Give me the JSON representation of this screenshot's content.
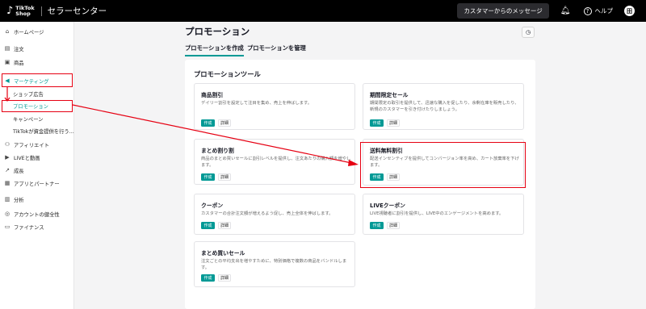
{
  "header": {
    "logo_brand_line1": "TikTok",
    "logo_brand_line2": "Shop",
    "app_title": "セラーセンター",
    "messages_button": "カスタマーからのメッセージ",
    "help_label": "ヘルプ",
    "avatar_initial": "田"
  },
  "sidebar": {
    "items": [
      {
        "label": "ホームページ",
        "icon": "home-icon"
      },
      {
        "label": "注文",
        "icon": "order-icon"
      },
      {
        "label": "商品",
        "icon": "product-icon"
      },
      {
        "label": "マーケティング",
        "icon": "megaphone-icon"
      },
      {
        "label": "アフィリエイト",
        "icon": "affiliate-icon"
      },
      {
        "label": "LIVEと動画",
        "icon": "video-icon"
      },
      {
        "label": "成長",
        "icon": "growth-icon"
      },
      {
        "label": "アプリとパートナー",
        "icon": "apps-icon"
      },
      {
        "label": "分析",
        "icon": "analytics-icon"
      },
      {
        "label": "アカウントの健全性",
        "icon": "health-icon"
      },
      {
        "label": "ファイナンス",
        "icon": "finance-icon"
      }
    ],
    "marketing_sub": [
      "ショップ広告",
      "プロモーション",
      "キャンペーン",
      "TikTokが資金提供を行う..."
    ]
  },
  "main": {
    "title": "プロモーション",
    "tabs": [
      "プロモーションを作成",
      "プロモーションを管理"
    ],
    "section_title": "プロモーションツール",
    "create_label": "作成",
    "detail_label": "詳細",
    "cards": [
      {
        "title": "商品割引",
        "desc": "デイリー割引を設定して注目を集め、売上を伸ばします。"
      },
      {
        "title": "期間限定セール",
        "desc": "期間限定の取引を提供して、迅速な購入を促したり、余剰在庫を販売したり、新規のカスタマーを引き付けたりしましょう。"
      },
      {
        "title": "まとめ割り割",
        "desc": "商品のまとめ買いセールに割引レベルを提供し、注文あたりの購入額を増やします。"
      },
      {
        "title": "送料無料割引",
        "desc": "配送インセンティブを提供してコンバージョン率を高め、カート放棄率を下げます。"
      },
      {
        "title": "クーポン",
        "desc": "カスタマーの合計注文額が増えるよう促し、売上全体を伸ばします。"
      },
      {
        "title": "LIVEクーポン",
        "desc": "LIVE視聴者に割引を提供し、LIVE中のエンゲージメントを高めます。"
      },
      {
        "title": "まとめ買いセール",
        "desc": "注文ごとの平均支出を増やすために、特別価格で複数の商品をバンドルします。"
      }
    ]
  },
  "colors": {
    "accent": "#009995",
    "annotation": "#e60012",
    "topbar": "#000000"
  }
}
